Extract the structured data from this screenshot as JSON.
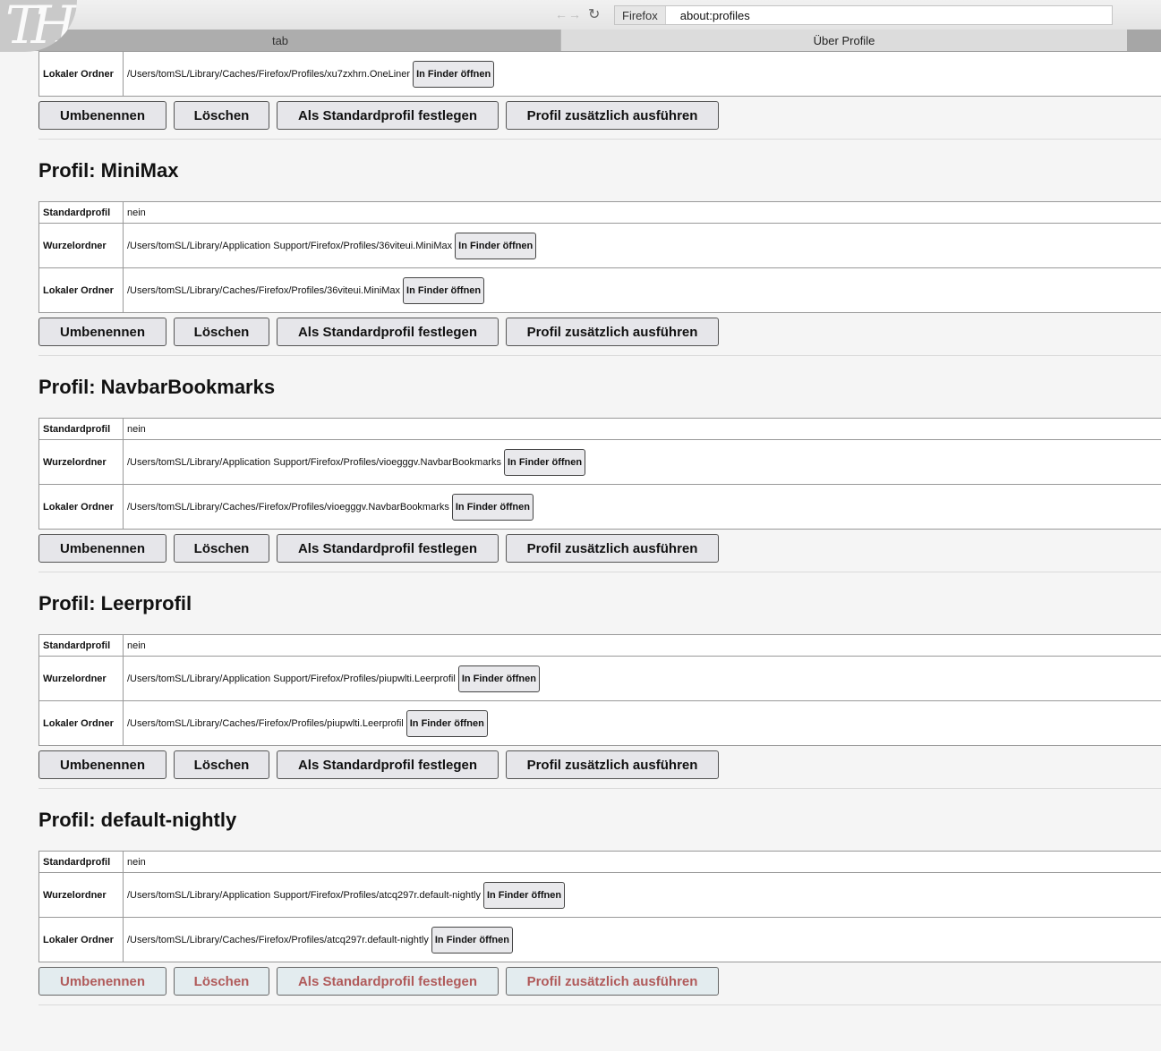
{
  "browser": {
    "logo_text": "TH",
    "nav_arrows": "←→",
    "reload_glyph": "↻",
    "identity": "Firefox",
    "url": "about:profiles",
    "tabs": [
      {
        "label": "tab"
      },
      {
        "label": "Über Profile"
      }
    ]
  },
  "labels": {
    "default_profile": "Standardprofil",
    "root_dir": "Wurzelordner",
    "local_dir": "Lokaler Ordner",
    "open_finder": "In Finder öffnen",
    "rename": "Umbenennen",
    "delete": "Löschen",
    "set_default": "Als Standardprofil festlegen",
    "run_additional": "Profil zusätzlich ausführen"
  },
  "partial_profile": {
    "local_dir": "/Users/tomSL/Library/Caches/Firefox/Profiles/xu7zxhrn.OneLiner"
  },
  "profiles": [
    {
      "title": "Profil: MiniMax",
      "is_default": "nein",
      "root_dir": "/Users/tomSL/Library/Application Support/Firefox/Profiles/36viteui.MiniMax",
      "local_dir": "/Users/tomSL/Library/Caches/Firefox/Profiles/36viteui.MiniMax"
    },
    {
      "title": "Profil: NavbarBookmarks",
      "is_default": "nein",
      "root_dir": "/Users/tomSL/Library/Application Support/Firefox/Profiles/vioegggv.NavbarBookmarks",
      "local_dir": "/Users/tomSL/Library/Caches/Firefox/Profiles/vioegggv.NavbarBookmarks"
    },
    {
      "title": "Profil: Leerprofil",
      "is_default": "nein",
      "root_dir": "/Users/tomSL/Library/Application Support/Firefox/Profiles/piupwlti.Leerprofil",
      "local_dir": "/Users/tomSL/Library/Caches/Firefox/Profiles/piupwlti.Leerprofil"
    },
    {
      "title": "Profil: default-nightly",
      "is_default": "nein",
      "root_dir": "/Users/tomSL/Library/Application Support/Firefox/Profiles/atcq297r.default-nightly",
      "local_dir": "/Users/tomSL/Library/Caches/Firefox/Profiles/atcq297r.default-nightly"
    }
  ]
}
